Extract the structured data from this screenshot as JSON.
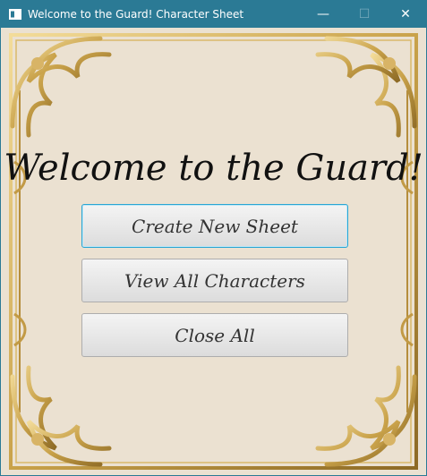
{
  "window": {
    "title": "Welcome to the Guard! Character Sheet",
    "controls": {
      "minimize": "—",
      "maximize": "☐",
      "close": "✕"
    }
  },
  "main": {
    "heading": "Welcome to the Guard!",
    "buttons": [
      {
        "label": "Create New Sheet",
        "focused": true
      },
      {
        "label": "View All Characters",
        "focused": false
      },
      {
        "label": "Close All",
        "focused": false
      }
    ]
  },
  "colors": {
    "titlebar": "#2b7a95",
    "background": "#ebe1d1",
    "frame_gold": "#c9a24a",
    "focus_border": "#2aa5d3"
  }
}
